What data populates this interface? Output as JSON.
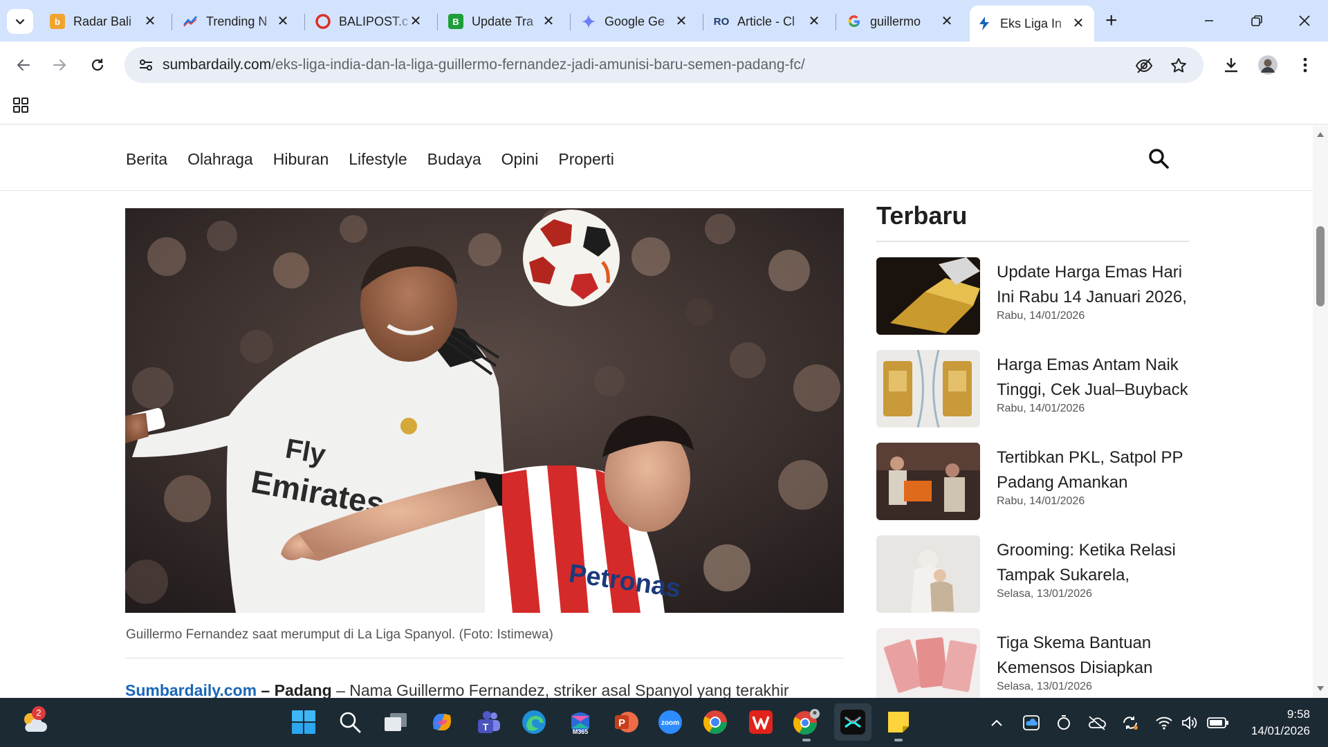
{
  "browser": {
    "tabs": [
      {
        "label": "Radar Bali",
        "icon": "radarbali-favicon",
        "color": "#f0a32e"
      },
      {
        "label": "Trending N",
        "icon": "trending-favicon",
        "color": "#1a73e8"
      },
      {
        "label": "BALIPOST.c",
        "icon": "balipost-favicon",
        "color": "#d93025"
      },
      {
        "label": "Update Tra",
        "icon": "update-favicon",
        "color": "#1e9e3a"
      },
      {
        "label": "Google Ge",
        "icon": "gemini-favicon",
        "color": "#6d7ff5"
      },
      {
        "label": "Article - Cl",
        "icon": "article-favicon",
        "color": "#1d3b6f"
      },
      {
        "label": "guillermo",
        "icon": "google-favicon",
        "color": "#4285f4"
      },
      {
        "label": "Eks Liga In",
        "icon": "sumbardaily-favicon",
        "color": "#1a66b8"
      }
    ],
    "active_tab_index": 7,
    "url_host": "sumbardaily.com",
    "url_path": "/eks-liga-india-dan-la-liga-guillermo-fernandez-jadi-amunisi-baru-semen-padang-fc/"
  },
  "site": {
    "nav": [
      "Berita",
      "Olahraga",
      "Hiburan",
      "Lifestyle",
      "Budaya",
      "Opini",
      "Properti"
    ],
    "caption": "Guillermo Fernandez saat merumput di La Liga Spanyol. (Foto: Istimewa)",
    "lead_brand": "Sumbardaily.com",
    "lead_city": " – Padang",
    "lead_text": " – Nama Guillermo Fernandez, striker asal Spanyol yang terakhir"
  },
  "hero_jerseys": [
    "Fly",
    "Emirates",
    "Petronas"
  ],
  "sidebar": {
    "heading": "Terbaru",
    "items": [
      {
        "title": "Update Harga Emas Hari Ini Rabu 14 Januari 2026,",
        "date": "Rabu, 14/01/2026"
      },
      {
        "title": "Harga Emas Antam Naik Tinggi, Cek Jual–Buyback",
        "date": "Rabu, 14/01/2026"
      },
      {
        "title": "Tertibkan PKL, Satpol PP Padang Amankan",
        "date": "Rabu, 14/01/2026"
      },
      {
        "title": "Grooming: Ketika Relasi Tampak Sukarela,",
        "date": "Selasa, 13/01/2026"
      },
      {
        "title": "Tiga Skema Bantuan Kemensos Disiapkan",
        "date": "Selasa, 13/01/2026"
      }
    ]
  },
  "taskbar": {
    "weather_badge": "2",
    "time": "9:58",
    "date": "14/01/2026"
  }
}
